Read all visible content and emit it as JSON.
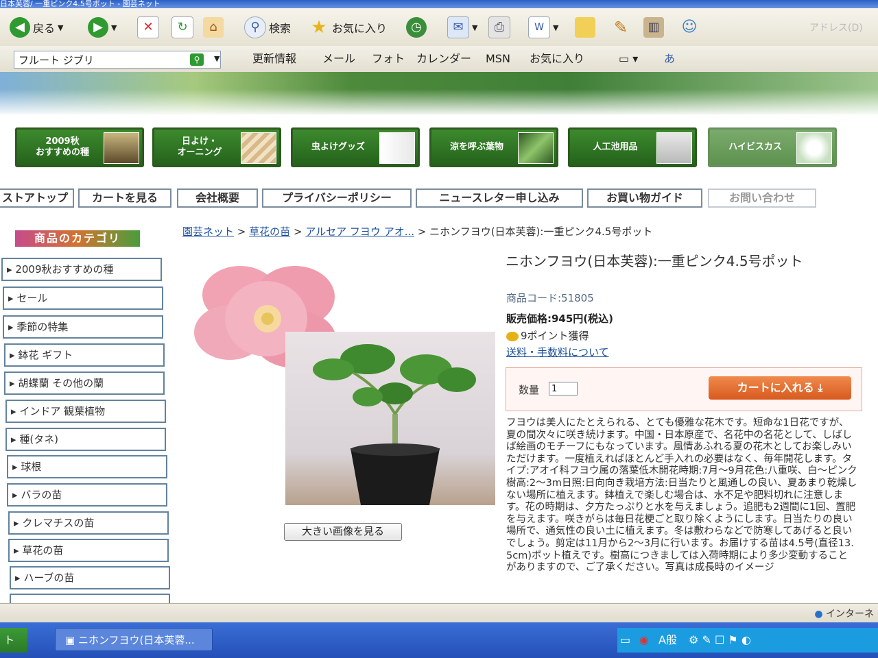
{
  "window": {
    "title": "日本芙蓉/ 一重ピンク4.5号ポット - 園芸ネット"
  },
  "toolbar": {
    "back_label": "戻る",
    "search_label": "検索",
    "favorites_label": "お気に入り",
    "address_label": "アドレス(D)"
  },
  "linksbar": {
    "search_value": "フルート ジブリ",
    "links": [
      "更新情報",
      "メール",
      "フォト",
      "カレンダー",
      "MSN",
      "お気に入り"
    ]
  },
  "categories": [
    "2009秋\nおすすめの種",
    "日よけ・\nオーニング",
    "虫よけグッズ",
    "涼を呼ぶ葉物",
    "人工池用品",
    "ハイビスカス"
  ],
  "nav": [
    "ストアトップ",
    "カートを見る",
    "会社概要",
    "プライバシーポリシー",
    "ニュースレター申し込み",
    "お買い物ガイド",
    "お問い合わせ"
  ],
  "sidebar": {
    "title": "商品のカテゴリ",
    "items": [
      "2009秋おすすめの種",
      "セール",
      "季節の特集",
      "鉢花 ギフト",
      "胡蝶蘭 その他の蘭",
      "インドア 観葉植物",
      "種(タネ)",
      "球根",
      "バラの苗",
      "クレマチスの苗",
      "草花の苗",
      "ハーブの苗"
    ]
  },
  "breadcrumb": {
    "links": [
      "園芸ネット",
      "草花の苗",
      "アルセア フヨウ アオ..."
    ],
    "current": "ニホンフヨウ(日本芙蓉):一重ピンク4.5号ポット",
    "sep": ">"
  },
  "product": {
    "title": "ニホンフヨウ(日本芙蓉):一重ピンク4.5号ポット",
    "code": "商品コード:51805",
    "price": "販売価格:945円(税込)",
    "points": "9ポイント獲得",
    "shipping_link": "送料・手数料について",
    "qty_label": "数量",
    "qty_value": "1",
    "cart_button": "カートに入れる",
    "big_image_button": "大きい画像を見る",
    "description": "フヨウは美人にたとえられる、とても優雅な花木です。短命な1日花ですが、夏の間次々に咲き続けます。中国・日本原産で、名花中の名花として、しばしば絵画のモチーフにもなっています。風情あふれる夏の花木としてお楽しみいただけます。一度植えればほとんど手入れの必要はなく、毎年開花します。タイプ:アオイ科フヨウ属の落葉低木開花時期:7月〜9月花色:八重咲、白〜ピンク樹高:2〜3m日照:日向向き栽培方法:日当たりと風通しの良い、夏あまり乾燥しない場所に植えます。鉢植えで楽しむ場合は、水不足や肥料切れに注意します。花の時期は、夕方たっぷりと水を与えましょう。追肥も2週間に1回、置肥を与えます。咲きがらは毎日花梗ごと取り除くようにします。日当たりの良い場所で、通気性の良い土に植えます。冬は敷わらなどで防寒してあげると良いでしょう。剪定は11月から2〜3月に行います。お届けする苗は4.5号(直径13.5cm)ポット植えです。樹高につきましては入荷時期により多少変動することがありますので、ご了承ください。写真は成長時のイメージ"
  },
  "statusbar": {
    "zone": "インターネ"
  },
  "taskbar": {
    "start": "ト",
    "task": "ニホンフヨウ(日本芙蓉...",
    "ime": "A般"
  },
  "colors": {
    "accent_green": "#2d6e22",
    "cart_orange": "#e06a2a",
    "link_blue": "#1b4f9c"
  }
}
